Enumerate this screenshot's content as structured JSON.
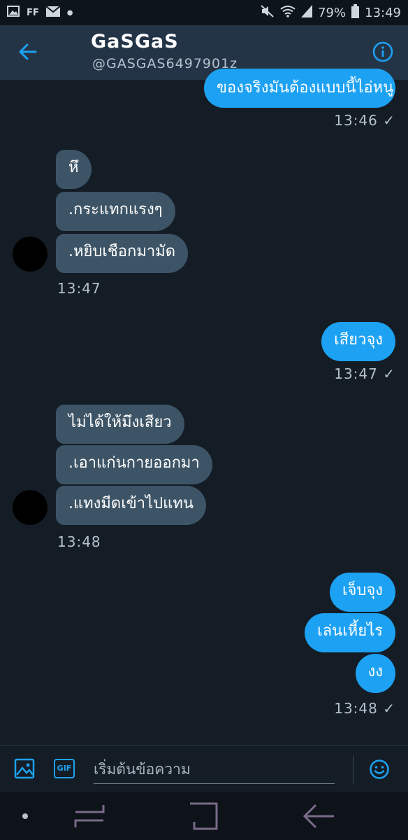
{
  "status_bar": {
    "left_icons": [
      "image-icon",
      "ff-icon",
      "mail-icon",
      "dot-icon"
    ],
    "ff_label": "FF",
    "battery": "79%",
    "time": "13:49"
  },
  "header": {
    "name": "GaSGaS",
    "handle": "@GASGAS6497901z"
  },
  "messages": [
    {
      "text": "ของจริงมันต้องแบบนี้ไอ่หนู",
      "dir": "out"
    },
    {
      "time": "13:46 ✓"
    },
    {
      "text": "หึ",
      "dir": "in"
    },
    {
      "text": ".กระแทกแรงๆ",
      "dir": "in"
    },
    {
      "text": ".หยิบเชือกมามัด",
      "dir": "in"
    },
    {
      "time": "13:47"
    },
    {
      "text": "เสียวจุง",
      "dir": "out"
    },
    {
      "time": "13:47 ✓"
    },
    {
      "text": "ไม่ได้ให้มึงเสียว",
      "dir": "in"
    },
    {
      "text": ".เอาแก่นกายออกมา",
      "dir": "in"
    },
    {
      "text": ".แทงมีดเข้าไปแทน",
      "dir": "in"
    },
    {
      "time": "13:48"
    },
    {
      "text": "เจ็บจุง",
      "dir": "out"
    },
    {
      "text": "เล่นเหี้ยไร",
      "dir": "out"
    },
    {
      "text": "งง",
      "dir": "out"
    },
    {
      "time": "13:48 ✓"
    }
  ],
  "composer": {
    "placeholder": "เริ่มต้นข้อความ",
    "gif_label": "GIF"
  },
  "colors": {
    "accent": "#1da1f2",
    "bg": "#141d26",
    "header": "#243447",
    "incoming": "#3d5466"
  }
}
